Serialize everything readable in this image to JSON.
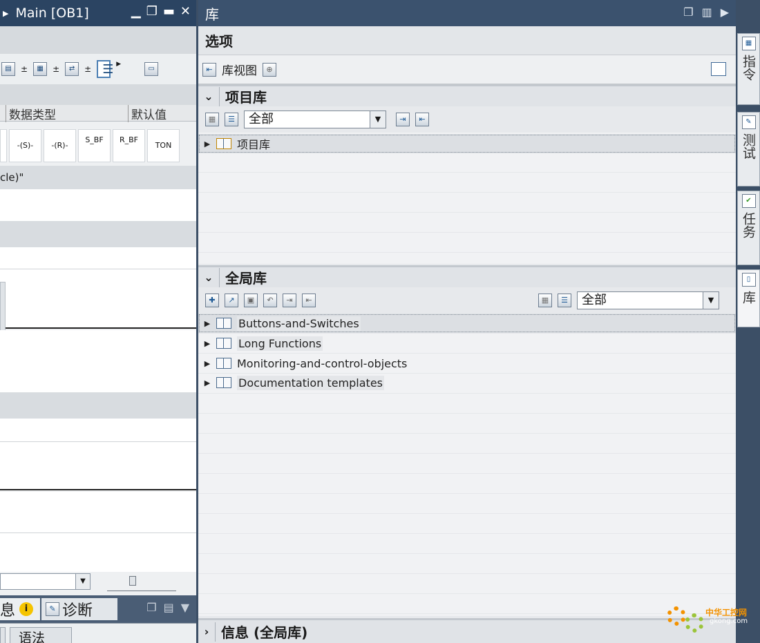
{
  "left_editor": {
    "title": "Main [OB1]",
    "columns": {
      "data_type": "数据类型",
      "default_value": "默认值"
    },
    "ladder_buttons": [
      "",
      "-(S)-",
      "-(R)-",
      "S_BF",
      "R_BF",
      "TON"
    ],
    "network_text": "cle)\"",
    "bottom_tabs": {
      "info": "息",
      "diagnostics": "诊断"
    },
    "sub_tab": "语法"
  },
  "library": {
    "title": "库",
    "options_label": "选项",
    "library_view_label": "库视图",
    "project_library": {
      "header": "项目库",
      "filter_value": "全部",
      "items": [
        {
          "label": "项目库"
        }
      ]
    },
    "global_library": {
      "header": "全局库",
      "filter_value": "全部",
      "items": [
        {
          "label": "Buttons-and-Switches"
        },
        {
          "label": "Long Functions"
        },
        {
          "label": "Monitoring-and-control-objects"
        },
        {
          "label": "Documentation templates"
        }
      ]
    },
    "info_bar": "信息 (全局库)"
  },
  "vertical_tabs": [
    "指令",
    "测试",
    "任务",
    "库"
  ],
  "watermark": {
    "text": "中华工控网",
    "url": "gkong.com"
  },
  "colors": {
    "title_bar": "#2b4462",
    "workspace_bg": "#3c4f66",
    "accent_orange": "#f39200"
  }
}
